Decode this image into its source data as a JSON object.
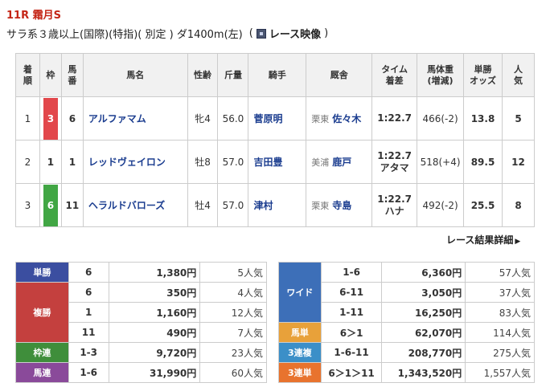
{
  "race": {
    "title": "11R 霜月S",
    "conditions": "サラ系３歳以上(国際)(特指)( 別定 ) ダ1400m(左)",
    "video_open": "(",
    "video_label": "レース映像",
    "video_close": ")"
  },
  "results": {
    "headers": {
      "rank": "着順",
      "frame": "枠",
      "num": "馬番",
      "horse": "馬名",
      "sexage": "性齢",
      "weight": "斤量",
      "jockey": "騎手",
      "trainer": "厩舎",
      "time": "タイム着差",
      "body": "馬体重(増減)",
      "odds": "単勝オッズ",
      "pop": "人気"
    },
    "rows": [
      {
        "rank": "1",
        "frame": "3",
        "frame_color": "#e2474b",
        "num": "6",
        "horse": "アルファマム",
        "sexage": "牝4",
        "weight": "56.0",
        "jockey": "菅原明",
        "aff": "栗東",
        "trainer": "佐々木",
        "time": "1:22.7",
        "margin": "",
        "body": "466(-2)",
        "odds": "13.8",
        "pop": "5"
      },
      {
        "rank": "2",
        "frame": "1",
        "frame_color": "#ffffff",
        "num": "1",
        "horse": "レッドヴェイロン",
        "sexage": "牡8",
        "weight": "57.0",
        "jockey": "吉田豊",
        "aff": "美浦",
        "trainer": "鹿戸",
        "time": "1:22.7",
        "margin": "アタマ",
        "body": "518(+4)",
        "odds": "89.5",
        "pop": "12"
      },
      {
        "rank": "3",
        "frame": "6",
        "frame_color": "#41a644",
        "num": "11",
        "horse": "ヘラルドバローズ",
        "sexage": "牡4",
        "weight": "57.0",
        "jockey": "津村",
        "aff": "栗東",
        "trainer": "寺島",
        "time": "1:22.7",
        "margin": "ハナ",
        "body": "492(-2)",
        "odds": "25.5",
        "pop": "8"
      }
    ]
  },
  "detail_link": "レース結果詳細",
  "payout_left": [
    {
      "label": "単勝",
      "color": "#3b4ea0",
      "lines": [
        {
          "num": "6",
          "amt": "1,380円",
          "pop": "5人気"
        }
      ]
    },
    {
      "label": "複勝",
      "color": "#c4403e",
      "lines": [
        {
          "num": "6",
          "amt": "350円",
          "pop": "4人気"
        },
        {
          "num": "1",
          "amt": "1,160円",
          "pop": "12人気"
        },
        {
          "num": "11",
          "amt": "490円",
          "pop": "7人気"
        }
      ]
    },
    {
      "label": "枠連",
      "color": "#3f8e3b",
      "lines": [
        {
          "num": "1-3",
          "amt": "9,720円",
          "pop": "23人気"
        }
      ]
    },
    {
      "label": "馬連",
      "color": "#8a4a9a",
      "lines": [
        {
          "num": "1-6",
          "amt": "31,990円",
          "pop": "60人気"
        }
      ]
    }
  ],
  "payout_right": [
    {
      "label": "ワイド",
      "color": "#3d6fb8",
      "lines": [
        {
          "num": "1-6",
          "amt": "6,360円",
          "pop": "57人気"
        },
        {
          "num": "6-11",
          "amt": "3,050円",
          "pop": "37人気"
        },
        {
          "num": "1-11",
          "amt": "16,250円",
          "pop": "83人気"
        }
      ]
    },
    {
      "label": "馬単",
      "color": "#e8a13a",
      "lines": [
        {
          "num": "6＞1",
          "amt": "62,070円",
          "pop": "114人気"
        }
      ]
    },
    {
      "label": "3連複",
      "color": "#3b8fc8",
      "lines": [
        {
          "num": "1-6-11",
          "amt": "208,770円",
          "pop": "275人気"
        }
      ]
    },
    {
      "label": "3連単",
      "color": "#e8732e",
      "lines": [
        {
          "num": "6＞1＞11",
          "amt": "1,343,520円",
          "pop": "1,557人気"
        }
      ]
    }
  ]
}
